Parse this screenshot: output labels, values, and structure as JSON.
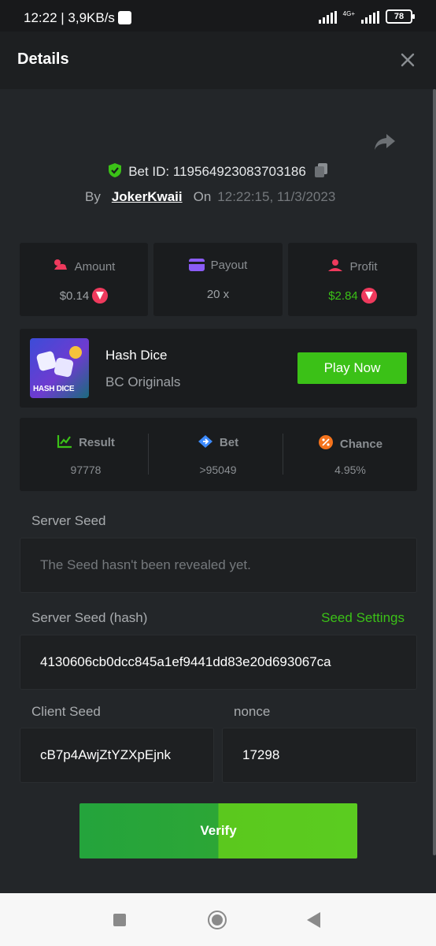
{
  "status_bar": {
    "time": "12:22 | 3,9KB/s",
    "network": "4G+",
    "battery": "78"
  },
  "header": {
    "title": "Details"
  },
  "bet": {
    "id_label": "Bet ID:",
    "id": "119564923083703186"
  },
  "byline": {
    "by": "By",
    "user": "JokerKwaii",
    "on": "On",
    "time": "12:22:15, 11/3/2023"
  },
  "stats": {
    "amount": {
      "label": "Amount",
      "value": "$0.14"
    },
    "payout": {
      "label": "Payout",
      "value": "20 x"
    },
    "profit": {
      "label": "Profit",
      "value": "$2.84"
    }
  },
  "game": {
    "name": "Hash Dice",
    "provider": "BC Originals",
    "thumb_text": "HASH DICE",
    "play_label": "Play Now"
  },
  "result": {
    "result": {
      "label": "Result",
      "value": "97778"
    },
    "bet": {
      "label": "Bet",
      "value": ">95049"
    },
    "chance": {
      "label": "Chance",
      "value": "4.95%"
    }
  },
  "seeds": {
    "server_seed_label": "Server Seed",
    "server_seed_value": "The Seed hasn't been revealed yet.",
    "server_hash_label": "Server Seed (hash)",
    "seed_settings": "Seed Settings",
    "server_hash_value": "4130606cb0dcc845a1ef9441dd83e20d693067ca",
    "client_seed_label": "Client Seed",
    "client_seed_value": "cB7p4AwjZtYZXpEjnk",
    "nonce_label": "nonce",
    "nonce_value": "17298"
  },
  "verify_label": "Verify",
  "colors": {
    "accent": "#3bc117",
    "background": "#232629",
    "card": "#1a1c1e"
  }
}
